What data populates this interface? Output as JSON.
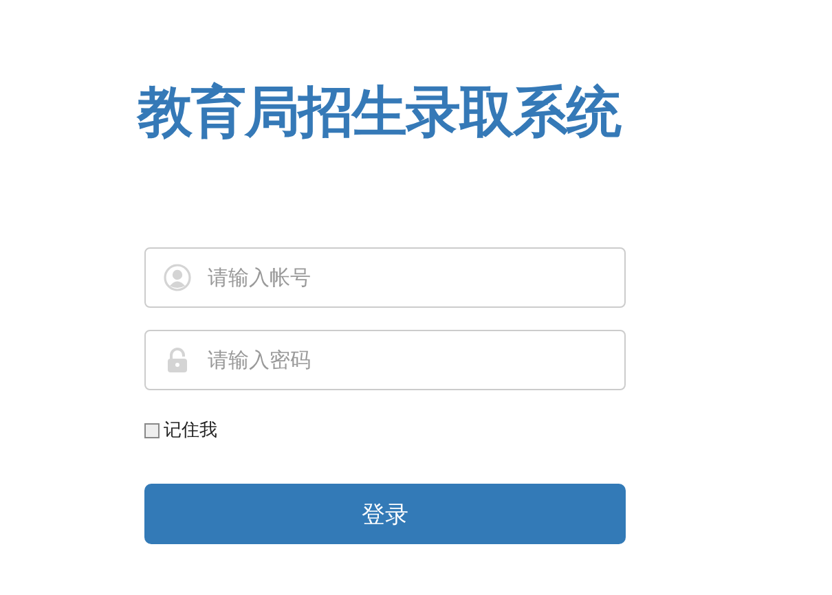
{
  "title": "教育局招生录取系统",
  "fields": [
    {
      "kind": "user",
      "placeholder": "请输入帐号"
    },
    {
      "kind": "password",
      "placeholder": "请输入密码"
    }
  ],
  "remember": {
    "label": "记住我",
    "checked": false
  },
  "login_button": "登录"
}
